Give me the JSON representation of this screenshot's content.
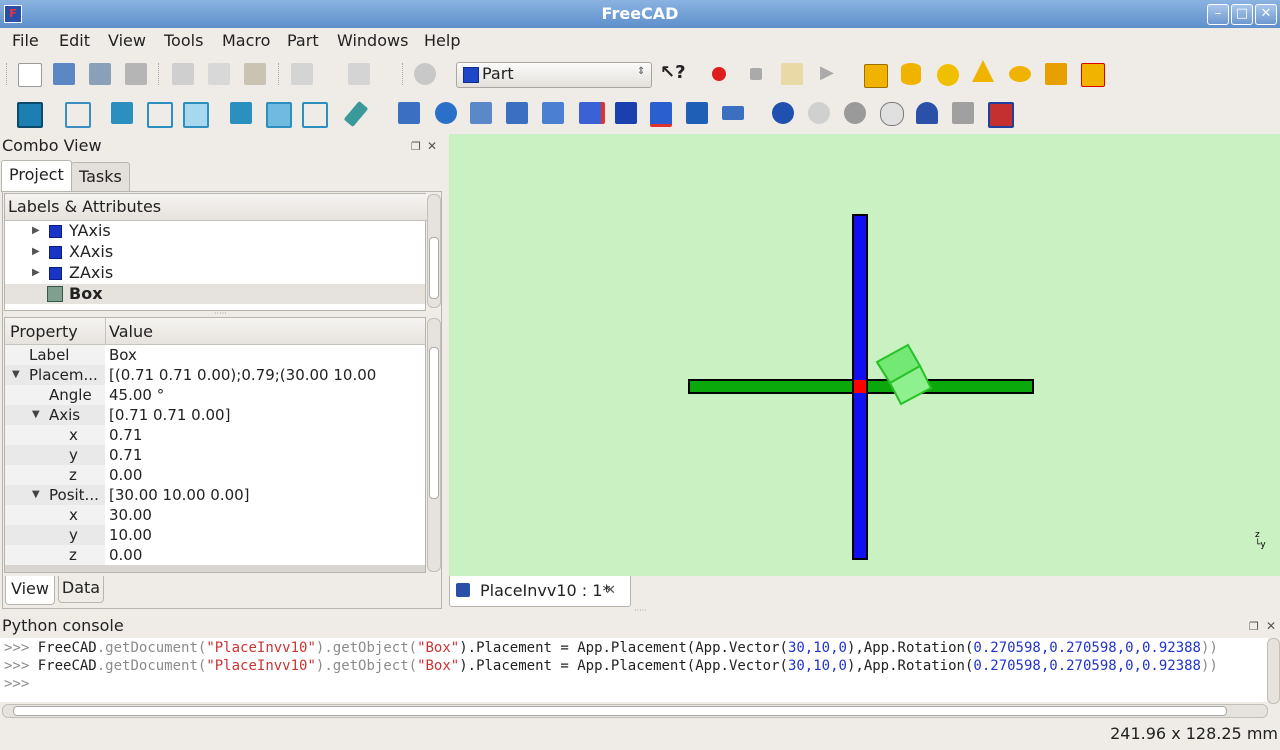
{
  "window": {
    "title": "FreeCAD"
  },
  "menu": [
    "File",
    "Edit",
    "View",
    "Tools",
    "Macro",
    "Part",
    "Windows",
    "Help"
  ],
  "toolbar": {
    "workbench": "Part",
    "icons": [
      "new-icon",
      "open-icon",
      "save-icon",
      "print-icon",
      "cut-icon",
      "copy-icon",
      "paste-icon",
      "undo-icon",
      "redo-icon",
      "refresh-icon",
      "whats-this-icon",
      "record-macro-icon",
      "stop-macro-icon",
      "edit-macro-icon",
      "run-macro-icon",
      "part-box-icon",
      "part-cylinder-icon",
      "part-sphere-icon",
      "part-cone-icon",
      "part-torus-icon",
      "part-primitives-icon",
      "part-shapebuilder-icon"
    ],
    "view_icons": [
      "fit-all-icon",
      "axonometric-icon",
      "front-view-icon",
      "top-view-icon",
      "right-view-icon",
      "rear-view-icon",
      "bottom-view-icon",
      "left-view-icon",
      "measure-icon",
      "extrude-icon",
      "revolve-icon",
      "mirror-icon",
      "fillet-icon",
      "chamfer-icon",
      "ruled-surface-icon",
      "loft-icon",
      "sweep-icon",
      "section-icon",
      "offset-icon",
      "thickness-icon",
      "boolean-icon",
      "cut-icon-b",
      "fuse-icon",
      "common-icon",
      "section-cross-icon",
      "shape-from-mesh-icon",
      "explode-icon"
    ]
  },
  "combo": {
    "title": "Combo View",
    "tabs": [
      "Project",
      "Tasks"
    ],
    "tree_header": "Labels & Attributes",
    "tree": [
      {
        "label": "YAxis"
      },
      {
        "label": "XAxis"
      },
      {
        "label": "ZAxis"
      },
      {
        "label": "Box"
      }
    ],
    "prop_header": {
      "property": "Property",
      "value": "Value"
    },
    "props": [
      {
        "name": "Label",
        "value": "Box"
      },
      {
        "name": "Placem...",
        "value": "[(0.71 0.71 0.00);0.79;(30.00 10.00 0.00)]"
      },
      {
        "name": "Angle",
        "value": "45.00 °"
      },
      {
        "name": "Axis",
        "value": "[0.71 0.71 0.00]"
      },
      {
        "name": "x",
        "value": "0.71"
      },
      {
        "name": "y",
        "value": "0.71"
      },
      {
        "name": "z",
        "value": "0.00"
      },
      {
        "name": "Posit...",
        "value": "[30.00 10.00 0.00]"
      },
      {
        "name": "x",
        "value": "30.00"
      },
      {
        "name": "y",
        "value": "10.00"
      },
      {
        "name": "z",
        "value": "0.00"
      }
    ],
    "bottom_tabs": [
      "View",
      "Data"
    ]
  },
  "doc_tab": {
    "label": "PlaceInvv10 : 1*"
  },
  "console": {
    "title": "Python console",
    "prompt": ">>>",
    "lines": [
      {
        "a": "FreeCAD",
        "b": ".getDocument(",
        "c": "\"PlaceInvv10\"",
        "d": ").getObject(",
        "e": "\"Box\"",
        "f": ").Placement = App.Placement(App.Vector(",
        "g": "30,10,0",
        "h": "),App.Rotation(",
        "i": "0.270598,0.270598,0,0.92388",
        "j": "))"
      },
      {
        "a": "FreeCAD",
        "b": ".getDocument(",
        "c": "\"PlaceInvv10\"",
        "d": ").getObject(",
        "e": "\"Box\"",
        "f": ").Placement = App.Placement(App.Vector(",
        "g": "30,10,0",
        "h": "),App.Rotation(",
        "i": "0.270598,0.270598,0,0.92388",
        "j": "))"
      }
    ]
  },
  "status": {
    "dimensions": "241.96 x 128.25 mm"
  },
  "colors": {
    "view_bg": "#c9f1c1",
    "x_axis": "#0aa80a",
    "y_axis": "#1010f0",
    "origin": "#ff0000",
    "box": "#6ee86e"
  }
}
